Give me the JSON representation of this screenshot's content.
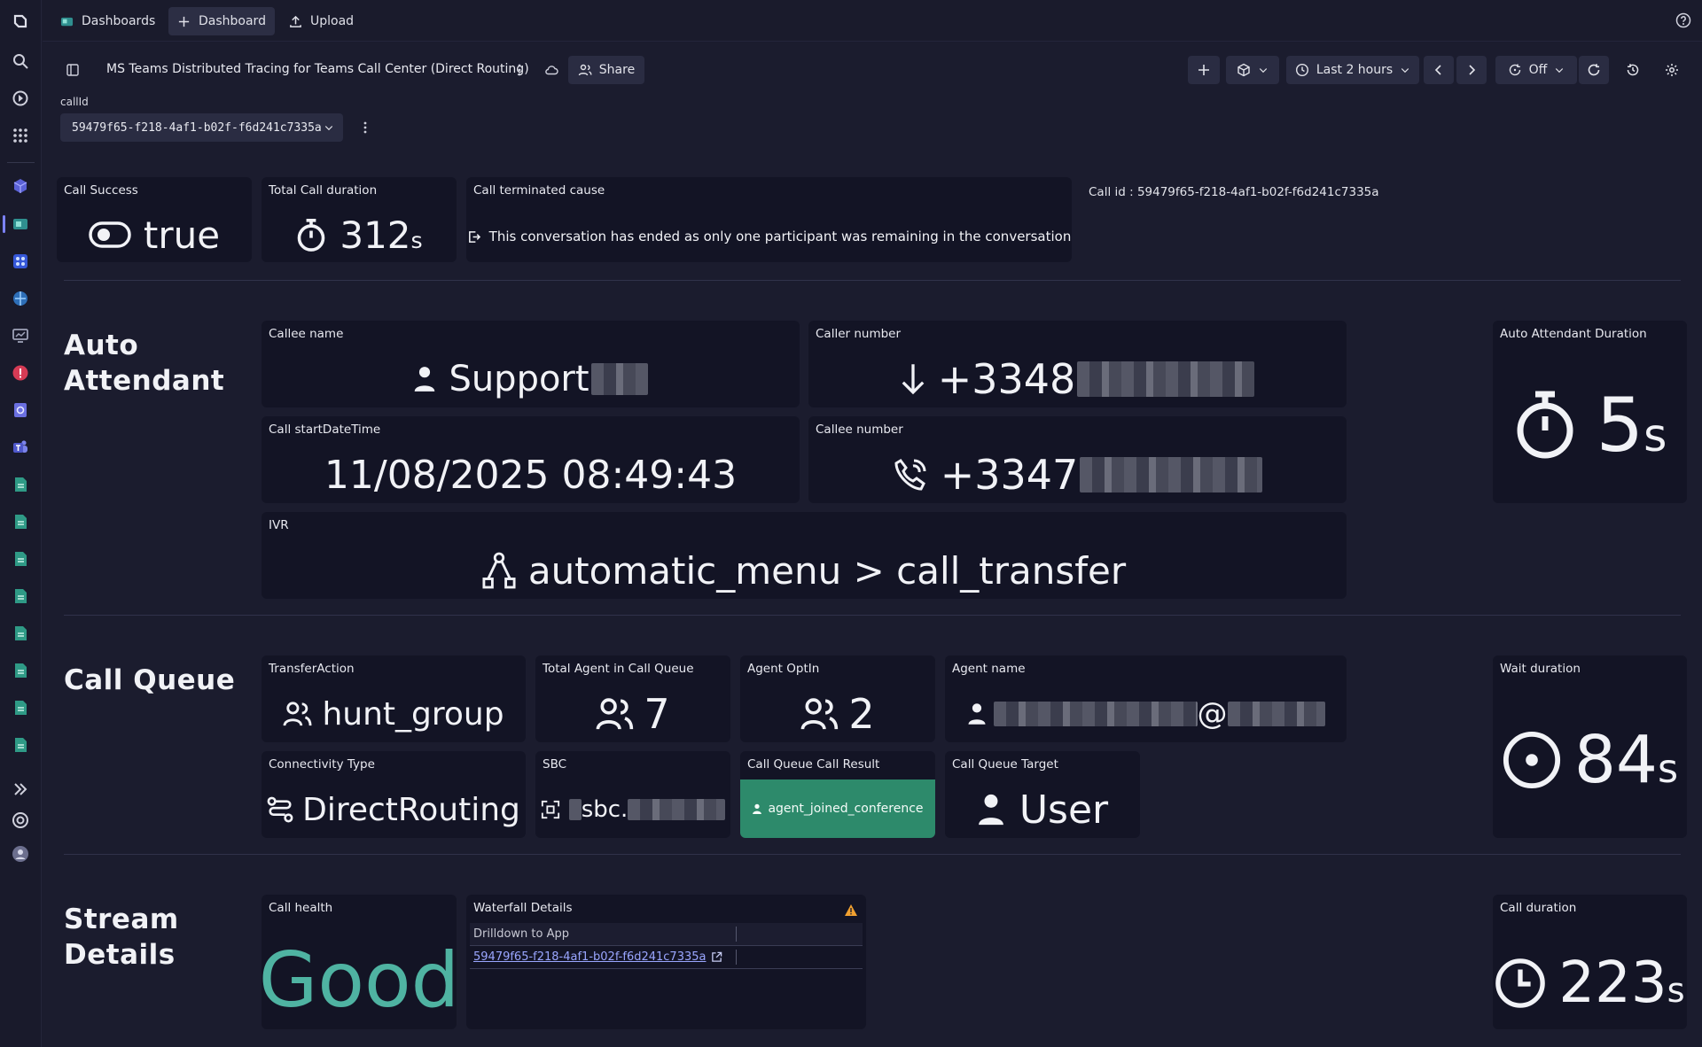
{
  "topbar": {
    "dashboards_label": "Dashboards",
    "new_dashboard_label": "Dashboard",
    "upload_label": "Upload"
  },
  "header": {
    "title": "MS Teams Distributed Tracing for Teams Call Center (Direct Routing)",
    "share_label": "Share",
    "timeframe_label": "Last 2 hours",
    "refresh_label": "Off"
  },
  "variable": {
    "label": "callId",
    "value": "59479f65-f218-4af1-b02f-f6d241c7335a"
  },
  "summary": {
    "call_success_title": "Call Success",
    "call_success_value": "true",
    "total_duration_title": "Total Call duration",
    "total_duration_value": "312",
    "total_duration_unit": "s",
    "terminated_title": "Call terminated cause",
    "terminated_value": "This conversation has ended as only one participant was remaining in the conversation",
    "call_id_text": "Call id : 59479f65-f218-4af1-b02f-f6d241c7335a"
  },
  "auto_attendant": {
    "section_title_line1": "Auto",
    "section_title_line2": "Attendant",
    "callee_name_title": "Callee name",
    "callee_name_value": "Support",
    "caller_number_title": "Caller number",
    "caller_number_value": "+3348",
    "start_title": "Call startDateTime",
    "start_value": "11/08/2025 08:49:43",
    "callee_number_title": "Callee number",
    "callee_number_value": "+3347",
    "ivr_title": "IVR",
    "ivr_value": "automatic_menu > call_transfer",
    "duration_title": "Auto Attendant Duration",
    "duration_value": "5",
    "duration_unit": "s"
  },
  "call_queue": {
    "section_title": "Call Queue",
    "transfer_title": "TransferAction",
    "transfer_value": "hunt_group",
    "total_agents_title": "Total Agent in Call Queue",
    "total_agents_value": "7",
    "optin_title": "Agent OptIn",
    "optin_value": "2",
    "agent_name_title": "Agent name",
    "agent_name_at": "@",
    "connectivity_title": "Connectivity Type",
    "connectivity_value": "DirectRouting",
    "sbc_title": "SBC",
    "sbc_value": "sbc.",
    "result_title": "Call Queue Call Result",
    "result_value": "agent_joined_conference",
    "target_title": "Call Queue Target",
    "target_value": "User",
    "wait_title": "Wait duration",
    "wait_value": "84",
    "wait_unit": "s"
  },
  "stream": {
    "section_title_line1": "Stream",
    "section_title_line2": "Details",
    "health_title": "Call health",
    "health_value": "Good",
    "waterfall_title": "Waterfall Details",
    "waterfall_col": "Drilldown to App",
    "waterfall_link": "59479f65-f218-4af1-b02f-f6d241c7335a",
    "duration_title": "Call duration",
    "duration_value": "223",
    "duration_unit": "s"
  },
  "colors": {
    "background": "#1b1c2e",
    "tile": "#131425",
    "success_green": "#2d8a6b",
    "health_teal": "#4fb3a2",
    "link_blue": "#9aa6ff",
    "warning_orange": "#f0a030"
  }
}
